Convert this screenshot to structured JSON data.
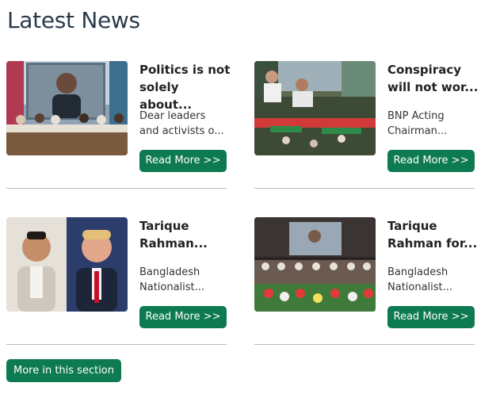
{
  "section": {
    "heading": "Latest News",
    "more_label": "More in this section"
  },
  "articles": [
    {
      "title": "Politics is not\nsolely about...",
      "excerpt": "Dear leaders\nand activists o...",
      "button": "Read More >>",
      "image": "conference-speaker-screen-photo"
    },
    {
      "title": "Conspiracy\nwill not wor...",
      "excerpt": "BNP Acting\nChairman...",
      "button": "Read More >>",
      "image": "street-rally-crowd-photo"
    },
    {
      "title": "Tarique\nRahman...",
      "excerpt": "Bangladesh\nNationalist...",
      "button": "Read More >>",
      "image": "two-portraits-photo"
    },
    {
      "title": "Tarique\nRahman for...",
      "excerpt": "Bangladesh\nNationalist...",
      "button": "Read More >>",
      "image": "stage-event-flowers-photo"
    }
  ],
  "colors": {
    "accent": "#0e7a52",
    "heading": "#2b3a4a",
    "divider": "#bdbdbd"
  }
}
